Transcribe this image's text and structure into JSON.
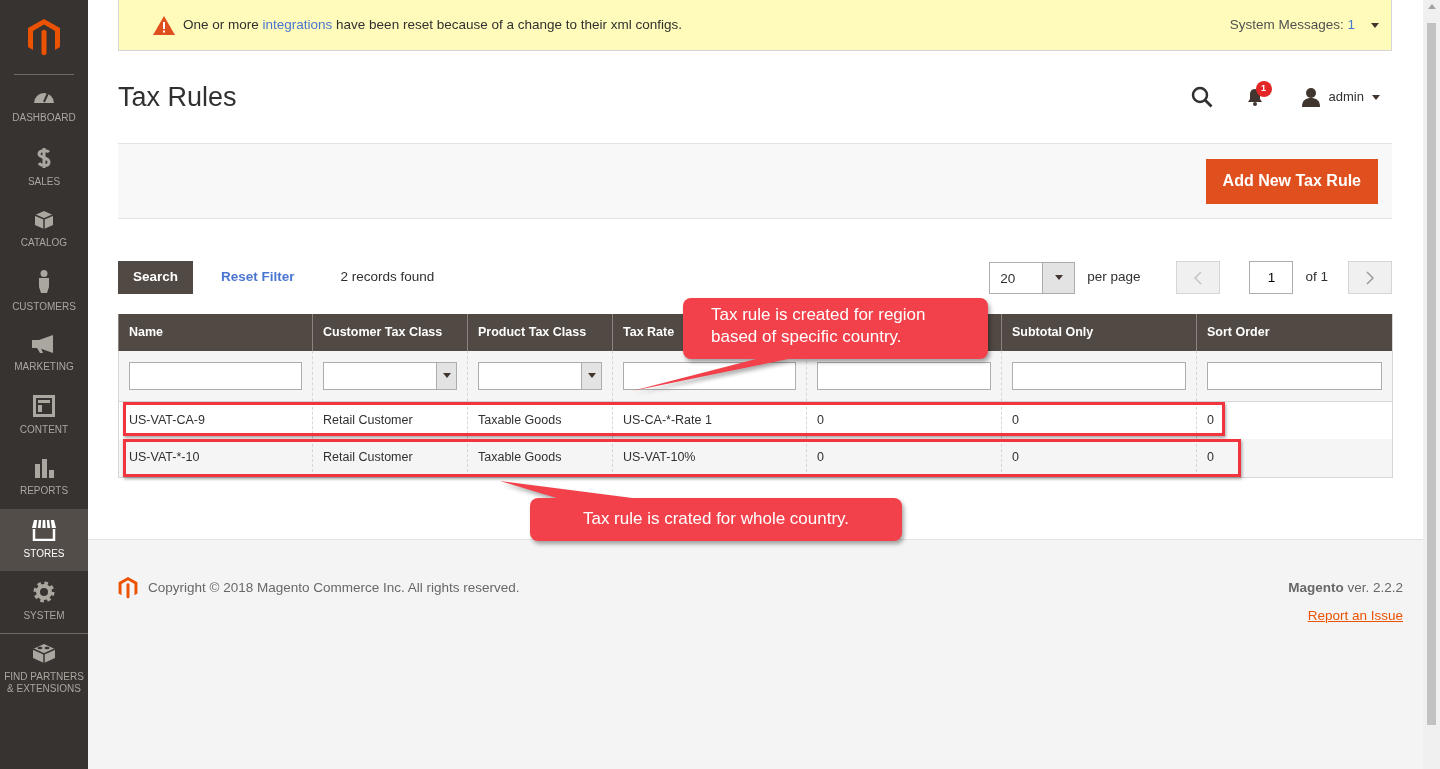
{
  "sidebar": {
    "items": [
      {
        "label": "DASHBOARD",
        "selected": false
      },
      {
        "label": "SALES",
        "selected": false
      },
      {
        "label": "CATALOG",
        "selected": false
      },
      {
        "label": "CUSTOMERS",
        "selected": false
      },
      {
        "label": "MARKETING",
        "selected": false
      },
      {
        "label": "CONTENT",
        "selected": false
      },
      {
        "label": "REPORTS",
        "selected": false
      },
      {
        "label": "STORES",
        "selected": true
      },
      {
        "label": "SYSTEM",
        "selected": false
      },
      {
        "label": "FIND PARTNERS & EXTENSIONS",
        "selected": false
      }
    ]
  },
  "system_message": {
    "before": "One or more ",
    "link": "integrations",
    "after": " have been reset because of a change to their xml configs.",
    "label": "System Messages:",
    "count": "1"
  },
  "page_title": "Tax Rules",
  "header": {
    "notifications": "1",
    "user": "admin"
  },
  "actions": {
    "add_button": "Add New Tax Rule"
  },
  "toolbar": {
    "search_button": "Search",
    "reset_link": "Reset Filter",
    "records": "2 records found",
    "per_page_value": "20",
    "per_page_label": "per page",
    "page": "1",
    "of_pages": "of 1"
  },
  "table": {
    "columns": [
      {
        "label": "Name",
        "kind": "text"
      },
      {
        "label": "Customer Tax Class",
        "kind": "select"
      },
      {
        "label": "Product Tax Class",
        "kind": "select"
      },
      {
        "label": "Tax Rate",
        "kind": "text"
      },
      {
        "kind": "text"
      },
      {
        "label": "Subtotal Only",
        "kind": "text"
      },
      {
        "label": "Sort Order",
        "kind": "text"
      }
    ],
    "rows": [
      {
        "cells": [
          "US-VAT-CA-9",
          "Retail Customer",
          "Taxable Goods",
          "US-CA-*-Rate 1",
          "0",
          "0",
          "0"
        ],
        "outlined": true
      },
      {
        "cells": [
          "US-VAT-*-10",
          "Retail Customer",
          "Taxable Goods",
          "US-VAT-10%",
          "0",
          "0",
          "0"
        ],
        "outlined": true
      }
    ]
  },
  "callouts": [
    {
      "text": "Tax rule is created for region based of specific country."
    },
    {
      "text": "Tax rule is crated for whole country."
    }
  ],
  "footer": {
    "copyright": "Copyright © 2018 Magento Commerce Inc. All rights reserved.",
    "version": "**Magento** ver. 2.2.2",
    "report_link": "Report an Issue"
  }
}
